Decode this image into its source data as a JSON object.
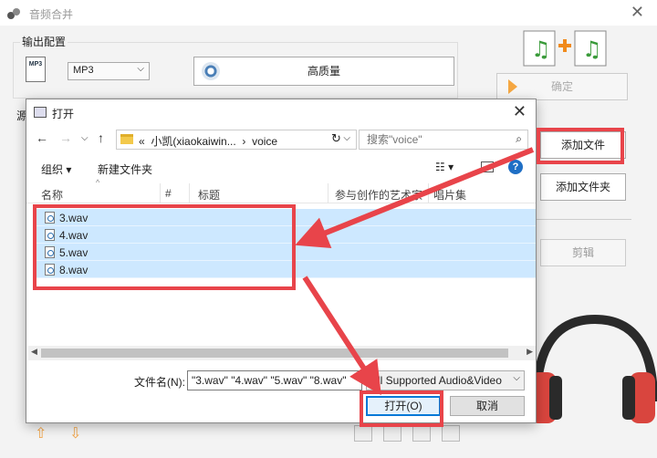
{
  "main_window": {
    "title": "音频合并",
    "output_group_label": "输出配置",
    "format_icon_text": "MP3",
    "format_value": "MP3",
    "quality_label": "高质量",
    "confirm_label": "确定",
    "source_label_char": "源",
    "add_file_label": "添加文件",
    "add_folder_label": "添加文件夹",
    "edit_label": "剪辑"
  },
  "dialog": {
    "title": "打开",
    "breadcrumb": {
      "prefix": "«",
      "folder": "小凯(xiaokaiwin...",
      "separator": "›",
      "current": "voice"
    },
    "search_placeholder": "搜索\"voice\"",
    "toolbar": {
      "organize_label": "组织 ▾",
      "new_folder_label": "新建文件夹"
    },
    "columns": [
      "名称",
      "#",
      "标题",
      "参与创作的艺术家",
      "唱片集"
    ],
    "files": [
      "3.wav",
      "4.wav",
      "5.wav",
      "8.wav"
    ],
    "filename_label": "文件名(N):",
    "filename_value": "\"3.wav\" \"4.wav\" \"5.wav\" \"8.wav\"",
    "filter_value": "All Supported Audio&Video",
    "open_label": "打开(O)",
    "cancel_label": "取消"
  },
  "colors": {
    "annotation_red": "#e8444a",
    "selection_blue": "#cde8ff",
    "primary_blue": "#0078d7"
  }
}
